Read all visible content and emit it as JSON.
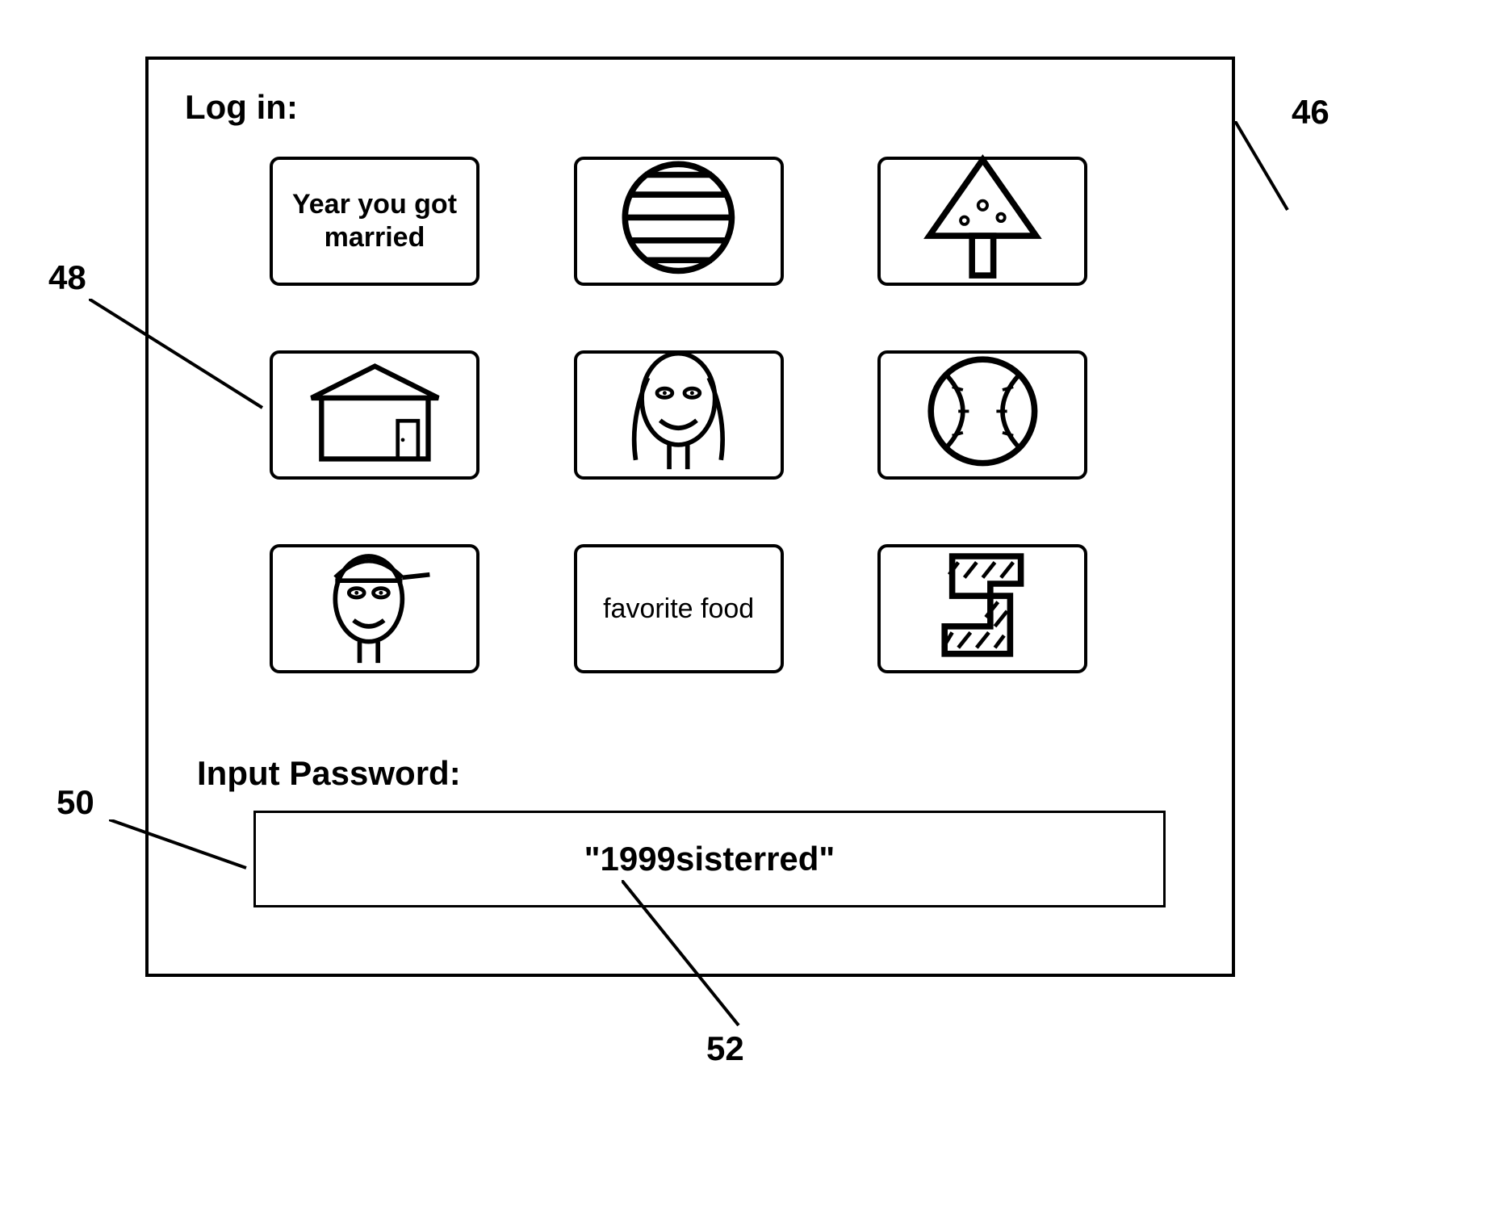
{
  "panel": {
    "title": "Log in:",
    "input_label": "Input Password:",
    "password_value": "\"1999sisterred\""
  },
  "tiles": [
    {
      "kind": "text",
      "label": "Year you got married",
      "name": "tile-year-married"
    },
    {
      "kind": "icon",
      "icon": "striped-circle",
      "name": "tile-striped-circle-icon"
    },
    {
      "kind": "icon",
      "icon": "tree",
      "name": "tile-tree-icon"
    },
    {
      "kind": "icon",
      "icon": "house",
      "name": "tile-house-icon"
    },
    {
      "kind": "icon",
      "icon": "face-longhair",
      "name": "tile-face-longhair-icon"
    },
    {
      "kind": "icon",
      "icon": "baseball",
      "name": "tile-baseball-icon"
    },
    {
      "kind": "icon",
      "icon": "face-cap",
      "name": "tile-face-cap-icon"
    },
    {
      "kind": "text",
      "label": "favorite food",
      "name": "tile-favorite-food"
    },
    {
      "kind": "icon",
      "icon": "striped-s",
      "name": "tile-striped-s-icon"
    }
  ],
  "callouts": {
    "panel_ref": "46",
    "grid_ref": "48",
    "password_box_ref": "50",
    "password_value_ref": "52"
  }
}
